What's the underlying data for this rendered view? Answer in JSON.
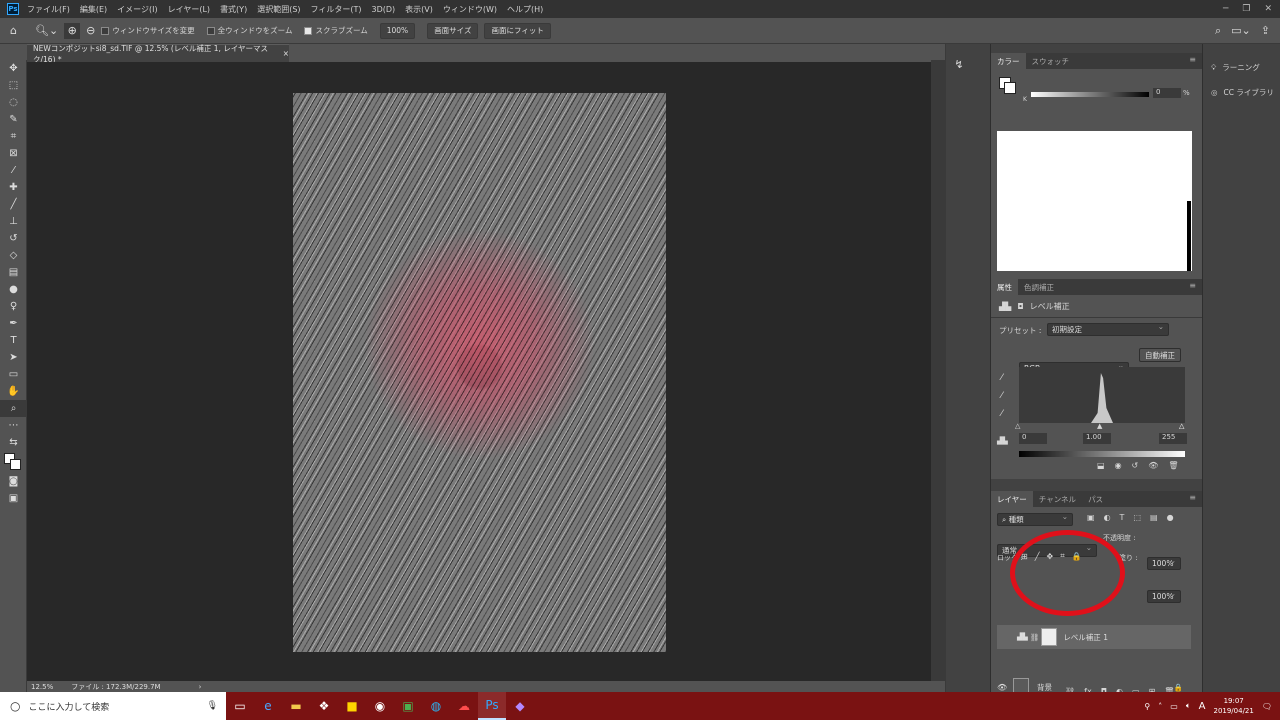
{
  "menubar": {
    "items": [
      "ファイル(F)",
      "編集(E)",
      "イメージ(I)",
      "レイヤー(L)",
      "書式(Y)",
      "選択範囲(S)",
      "フィルター(T)",
      "3D(D)",
      "表示(V)",
      "ウィンドウ(W)",
      "ヘルプ(H)"
    ]
  },
  "options": {
    "resize_windows": "ウィンドウサイズを変更",
    "zoom_all": "全ウィンドウをズーム",
    "scrubby_zoom": "スクラブズーム",
    "zoom_value": "100%",
    "fit_screen": "画面サイズ",
    "fill_screen": "画面にフィット"
  },
  "document": {
    "tab_title": "NEWコンポジットsi8_sd.TIF @ 12.5% (レベル補正 1, レイヤーマスク/16) *",
    "tab_close": "×",
    "zoom": "12.5%",
    "file_info": "ファイル : 172.3M/229.7M",
    "status_arrow": "›"
  },
  "color_panel": {
    "tab_color": "カラー",
    "tab_swatches": "スウォッチ",
    "k_label": "K",
    "k_value": "0",
    "k_unit": "%"
  },
  "properties_panel": {
    "tab_props": "属性",
    "tab_adjust": "色調補正",
    "title": "レベル補正",
    "preset_label": "プリセット :",
    "preset_value": "初期設定",
    "channel": "RGB",
    "auto_button": "自動補正",
    "input_black": "0",
    "input_gamma": "1.00",
    "input_white": "255"
  },
  "layers_panel": {
    "tab_layers": "レイヤー",
    "tab_channels": "チャンネル",
    "tab_paths": "パス",
    "filter_kind": "種類",
    "blend_mode": "通常",
    "opacity_label": "不透明度 :",
    "opacity_value": "100%",
    "lock_label": "ロック :",
    "fill_label": "塗り :",
    "fill_value": "100%",
    "layers": [
      {
        "name": "レベル補正 1"
      },
      {
        "name": "背景"
      }
    ]
  },
  "cc_dock": {
    "learn": "ラーニング",
    "libraries": "CC ライブラリ"
  },
  "taskbar": {
    "search_placeholder": "ここに入力して検索",
    "time": "19:07",
    "date": "2019/04/21",
    "ime": "A"
  },
  "colors": {
    "annotation": "#e0101a",
    "taskbar": "#7a1212"
  }
}
